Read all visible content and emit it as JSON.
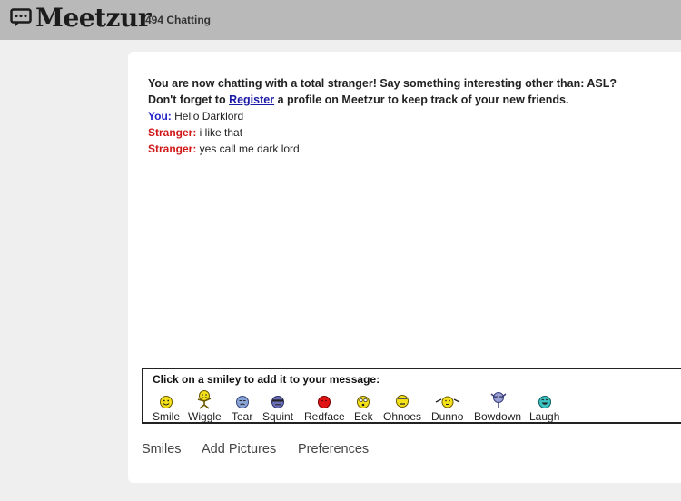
{
  "header": {
    "brand": "Meetzur",
    "chatting_count": "494 Chatting",
    "icon": "chat-bubble-icon"
  },
  "chat": {
    "intro_line": "You are now chatting with a total stranger! Say something interesting other than: ASL?",
    "register_prefix": "Don't forget to ",
    "register_link": "Register",
    "register_suffix": " a profile on Meetzur to keep track of your new friends.",
    "messages": [
      {
        "speaker": "You:",
        "text": " Hello Darklord"
      },
      {
        "speaker": "Stranger:",
        "text": " i like that"
      },
      {
        "speaker": "Stranger:",
        "text": " yes call me dark lord"
      }
    ]
  },
  "smileys": {
    "prompt": "Click on a smiley to add it to your message:",
    "items": [
      {
        "label": "Smile",
        "icon": "smile-icon",
        "color": "#f5e11a"
      },
      {
        "label": "Wiggle",
        "icon": "wiggle-icon",
        "color": "#f5e11a"
      },
      {
        "label": "Tear",
        "icon": "tear-icon",
        "color": "#8aa3d6"
      },
      {
        "label": "Squint",
        "icon": "squint-icon",
        "color": "#6b6fb5"
      },
      {
        "label": "Redface",
        "icon": "redface-icon",
        "color": "#e01414"
      },
      {
        "label": "Eek",
        "icon": "eek-icon",
        "color": "#f5e11a"
      },
      {
        "label": "Ohnoes",
        "icon": "ohnoes-icon",
        "color": "#f5e11a"
      },
      {
        "label": "Dunno",
        "icon": "dunno-icon",
        "color": "#f5e11a"
      },
      {
        "label": "Bowdown",
        "icon": "bowdown-icon",
        "color": "#9aa0d8"
      },
      {
        "label": "Laugh",
        "icon": "laugh-icon",
        "color": "#3cc4c4"
      }
    ]
  },
  "tabs": [
    {
      "label": "Smiles"
    },
    {
      "label": "Add Pictures"
    },
    {
      "label": "Preferences"
    }
  ]
}
